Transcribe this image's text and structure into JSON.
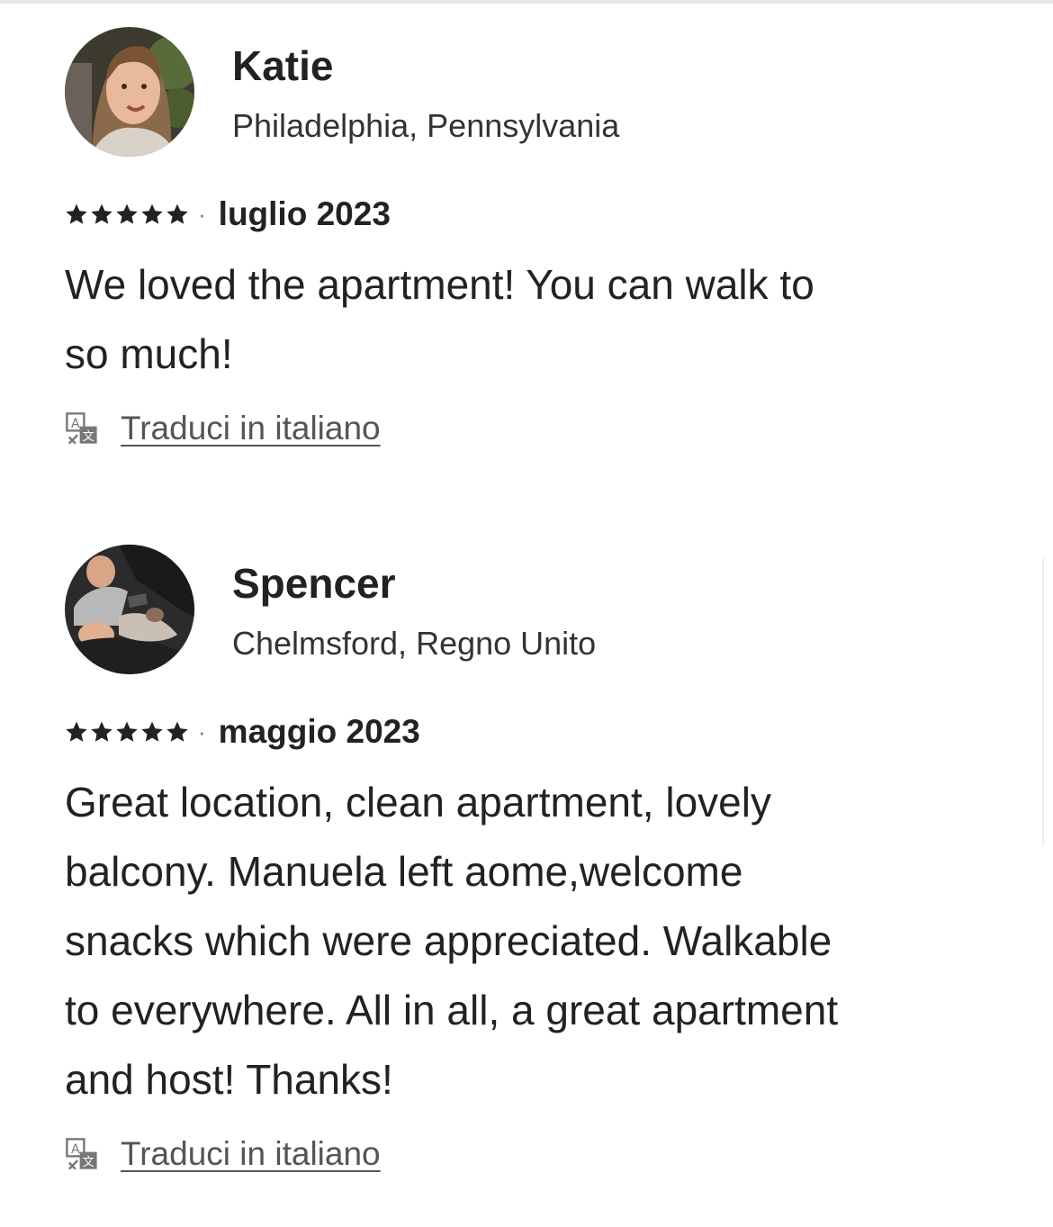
{
  "reviews": [
    {
      "name": "Katie",
      "location": "Philadelphia, Pennsylvania",
      "rating": 5,
      "stars_text": "★★★★★",
      "separator": "·",
      "date": "luglio 2023",
      "text": "We loved the apartment! You can walk to\nso much!",
      "translate_label": "Traduci in italiano",
      "avatar_icon": "profile-photo"
    },
    {
      "name": "Spencer",
      "location": "Chelmsford, Regno Unito",
      "rating": 5,
      "stars_text": "★★★★★",
      "separator": "·",
      "date": "maggio 2023",
      "text": "Great location, clean apartment, lovely\nbalcony. Manuela left aome,welcome\nsnacks which were appreciated.  Walkable\nto everywhere.  All in all, a great apartment\nand host! Thanks!",
      "translate_label": "Traduci in italiano",
      "avatar_icon": "profile-photo"
    }
  ],
  "icons": {
    "star": "star-icon",
    "translate": "translate-icon"
  },
  "colors": {
    "text": "#222222",
    "secondary": "#717171",
    "link": "#555555"
  }
}
